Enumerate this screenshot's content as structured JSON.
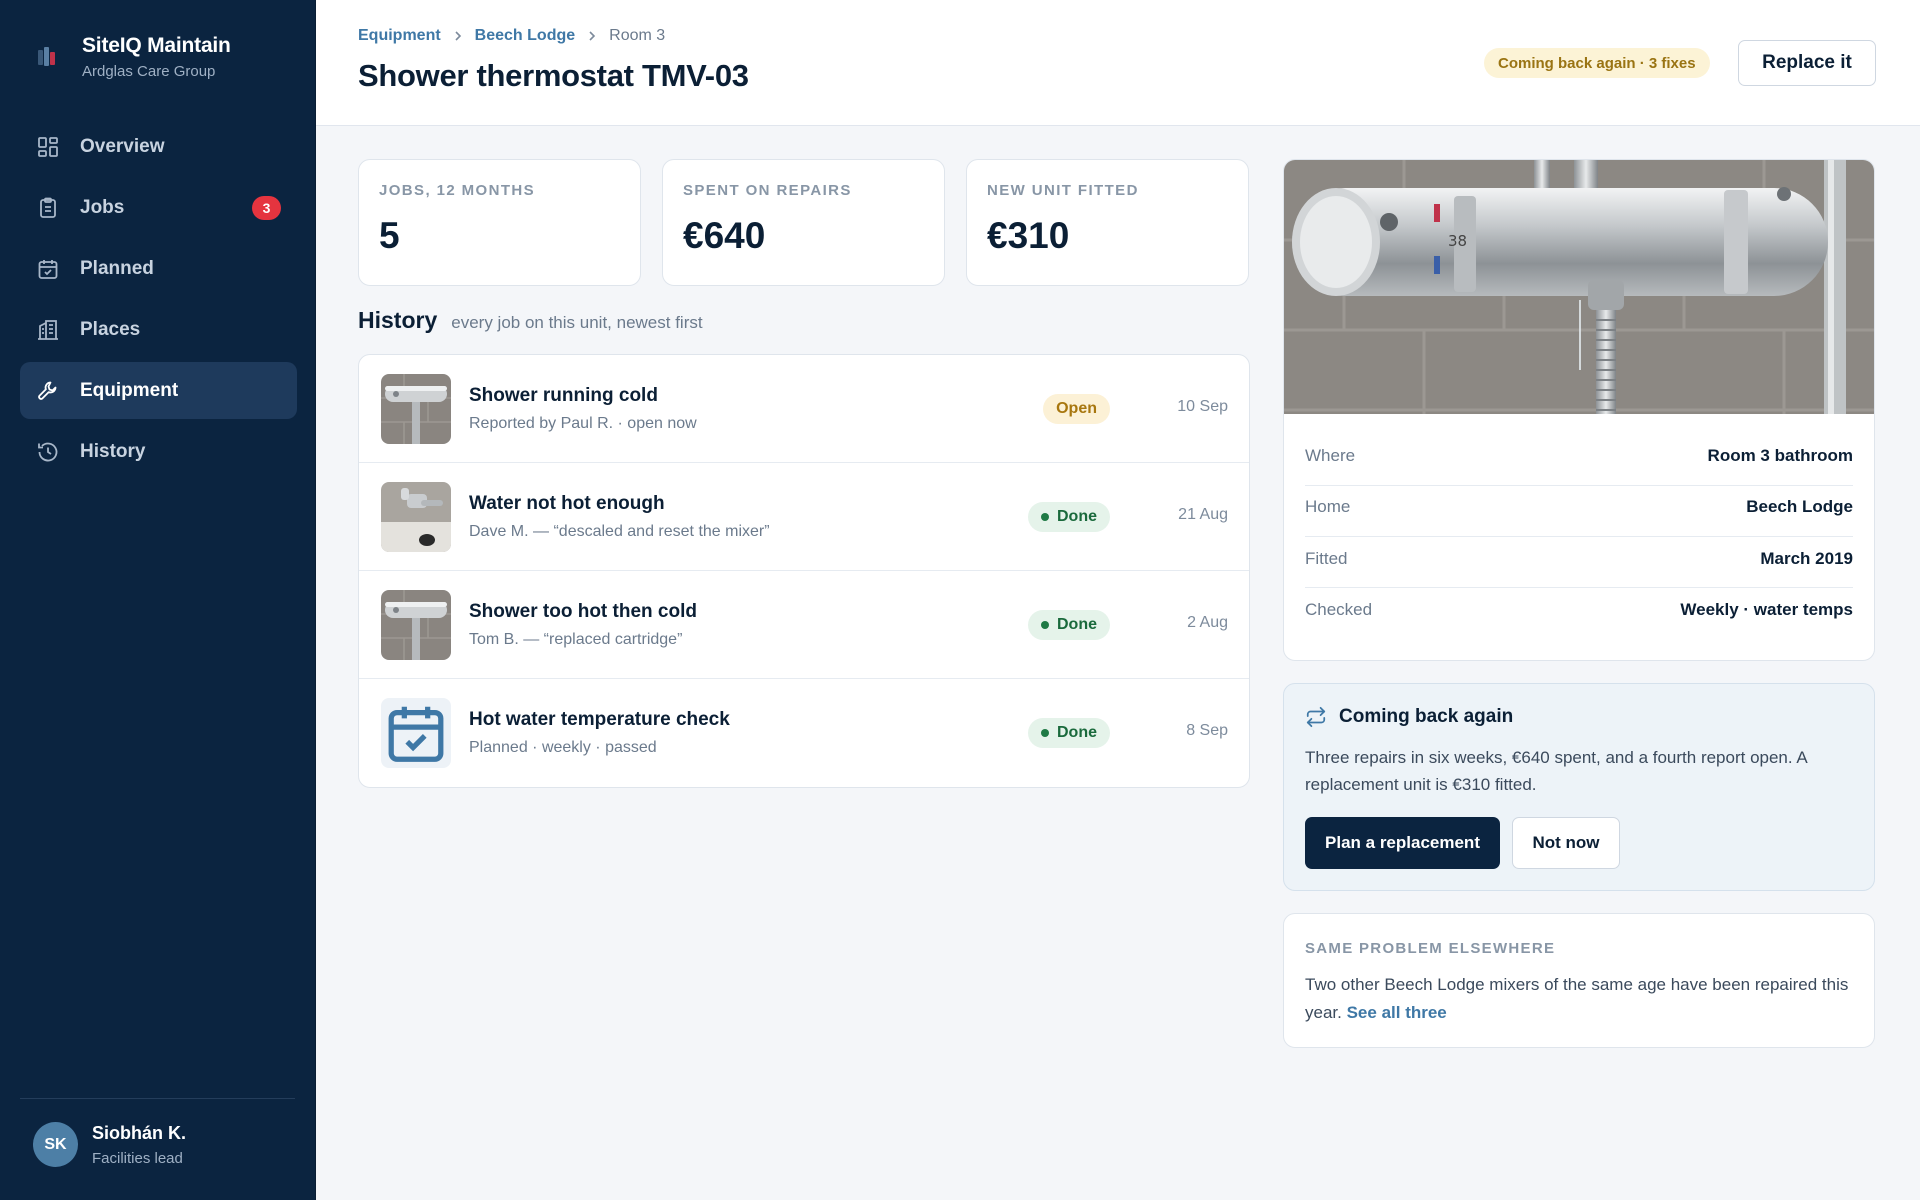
{
  "brand": {
    "name": "SiteIQ Maintain",
    "org": "Ardglas Care Group",
    "icon": "brand-logo-icon"
  },
  "nav": {
    "items": [
      {
        "label": "Overview",
        "icon": "grid-icon",
        "active": false
      },
      {
        "label": "Jobs",
        "icon": "clipboard-icon",
        "active": false,
        "badge": "3"
      },
      {
        "label": "Planned",
        "icon": "calendar-check-icon",
        "active": false
      },
      {
        "label": "Places",
        "icon": "building-icon",
        "active": false
      },
      {
        "label": "Equipment",
        "icon": "wrench-icon",
        "active": true
      },
      {
        "label": "History",
        "icon": "history-icon",
        "active": false
      }
    ]
  },
  "user": {
    "initials": "SK",
    "name": "Siobhán K.",
    "role": "Facilities lead"
  },
  "breadcrumb": {
    "items": [
      "Equipment",
      "Beech Lodge",
      "Room 3"
    ]
  },
  "page": {
    "title": "Shower thermostat TMV-03"
  },
  "header": {
    "warning_pill": "Coming back again · 3 fixes",
    "replace_label": "Replace it"
  },
  "stats": [
    {
      "label": "JOBS, 12 MONTHS",
      "value": "5"
    },
    {
      "label": "SPENT ON REPAIRS",
      "value": "€640"
    },
    {
      "label": "NEW UNIT FITTED",
      "value": "€310"
    }
  ],
  "history": {
    "title": "History",
    "subtitle": "every job on this unit, newest first",
    "rows": [
      {
        "title": "Shower running cold",
        "sub": "Reported by Paul R. · open now",
        "status": "Open",
        "date": "10 Sep",
        "thumb": "photo"
      },
      {
        "title": "Water not hot enough",
        "sub": "Dave M. — “descaled and reset the mixer”",
        "status": "Done",
        "date": "21 Aug",
        "thumb": "photo"
      },
      {
        "title": "Shower too hot then cold",
        "sub": "Tom B. — “replaced cartridge”",
        "status": "Done",
        "date": "2 Aug",
        "thumb": "photo"
      },
      {
        "title": "Hot water temperature check",
        "sub": "Planned · weekly · passed",
        "status": "Done",
        "date": "8 Sep",
        "thumb": "calendar-check-icon"
      }
    ]
  },
  "details": {
    "rows": [
      {
        "key": "Where",
        "value": "Room 3 bathroom"
      },
      {
        "key": "Home",
        "value": "Beech Lodge"
      },
      {
        "key": "Fitted",
        "value": "March 2019"
      },
      {
        "key": "Checked",
        "value": "Weekly · water temps"
      }
    ]
  },
  "alert": {
    "title": "Coming back again",
    "body": "Three repairs in six weeks, €640 spent, and a fourth report open. A replacement unit is €310 fitted.",
    "primary_label": "Plan a replacement",
    "secondary_label": "Not now"
  },
  "elsewhere": {
    "label": "SAME PROBLEM ELSEWHERE",
    "body": "Two other Beech Lodge mixers of the same age have been repaired this year.",
    "link": "See all three"
  },
  "colors": {
    "sidebar": "#0b2440",
    "accent": "#3f78a6",
    "badge": "#e5343f",
    "done": "#1f7a45",
    "open": "#a8770f"
  }
}
